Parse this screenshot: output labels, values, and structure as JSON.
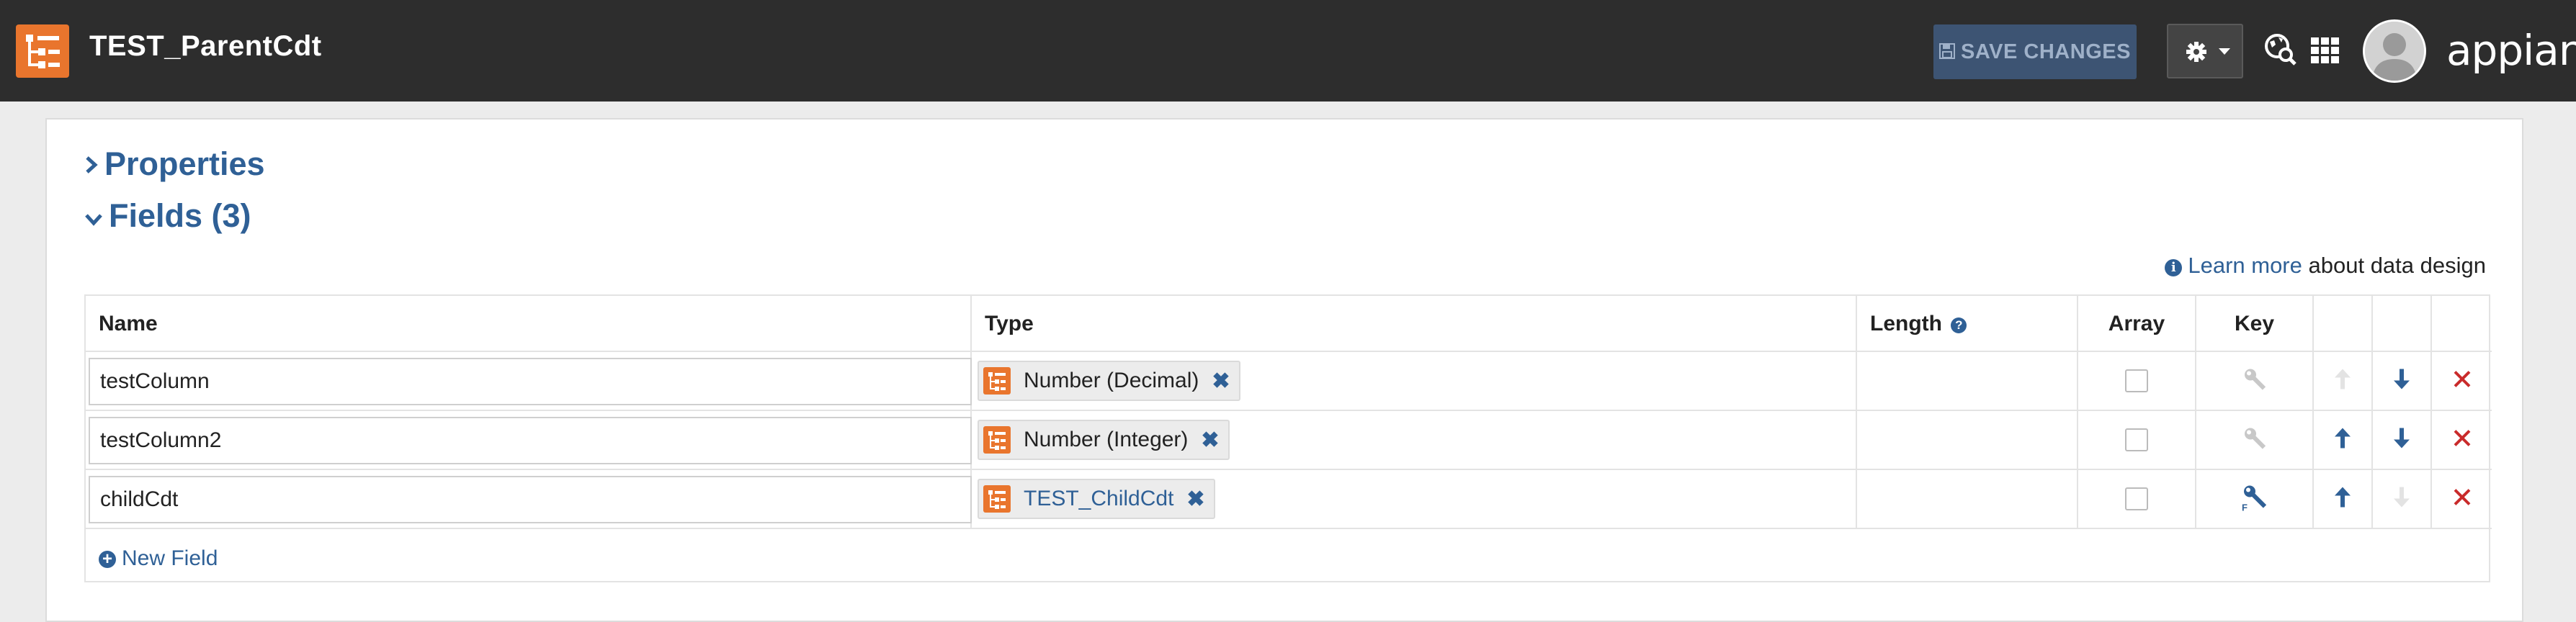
{
  "header": {
    "title": "TEST_ParentCdt",
    "save_label": "SAVE CHANGES",
    "brand": "appian",
    "icons": {
      "app": "record-type-icon",
      "settings": "gear-icon",
      "navigator": "globe-search-icon",
      "apps": "app-grid-icon",
      "user": "avatar-icon"
    },
    "colors": {
      "bar": "#2d2d2d",
      "save_bg": "#3d5473",
      "app_icon": "#e9752d"
    }
  },
  "sections": {
    "properties": "Properties",
    "fields": "Fields (3)"
  },
  "learn": {
    "link": "Learn more",
    "rest": "about data design"
  },
  "table": {
    "headers": {
      "name": "Name",
      "type": "Type",
      "length": "Length",
      "array": "Array",
      "key": "Key"
    },
    "rows": [
      {
        "name": "testColumn",
        "type": "Number (Decimal)",
        "type_is_link": false,
        "array": false,
        "key": "inactive",
        "up": "disabled",
        "down": "enabled"
      },
      {
        "name": "testColumn2",
        "type": "Number (Integer)",
        "type_is_link": false,
        "array": false,
        "key": "inactive",
        "up": "enabled",
        "down": "enabled"
      },
      {
        "name": "childCdt",
        "type": "TEST_ChildCdt",
        "type_is_link": true,
        "array": false,
        "key": "foreign-key",
        "up": "enabled",
        "down": "disabled"
      }
    ],
    "new_field_label": "New Field"
  },
  "accent_colors": {
    "link": "#2f6096",
    "delete": "#c92a2a"
  }
}
